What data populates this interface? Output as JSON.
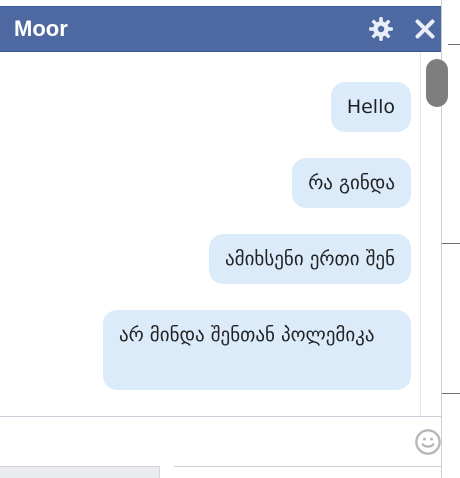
{
  "chat": {
    "title": "Moor",
    "messages": [
      {
        "text": "Hello"
      },
      {
        "text": "რა გინდა"
      },
      {
        "text": "ამიხსენი ერთი შენ"
      },
      {
        "text": "არ მინდა შენთან პოლემიკა"
      }
    ],
    "composer": {
      "value": "",
      "placeholder": ""
    },
    "icons": {
      "settings": "gear-icon",
      "close": "close-icon",
      "emoji": "smiley-icon"
    },
    "colors": {
      "header": "#4e69a2",
      "bubble": "#dcebfa",
      "text": "#222222"
    }
  }
}
